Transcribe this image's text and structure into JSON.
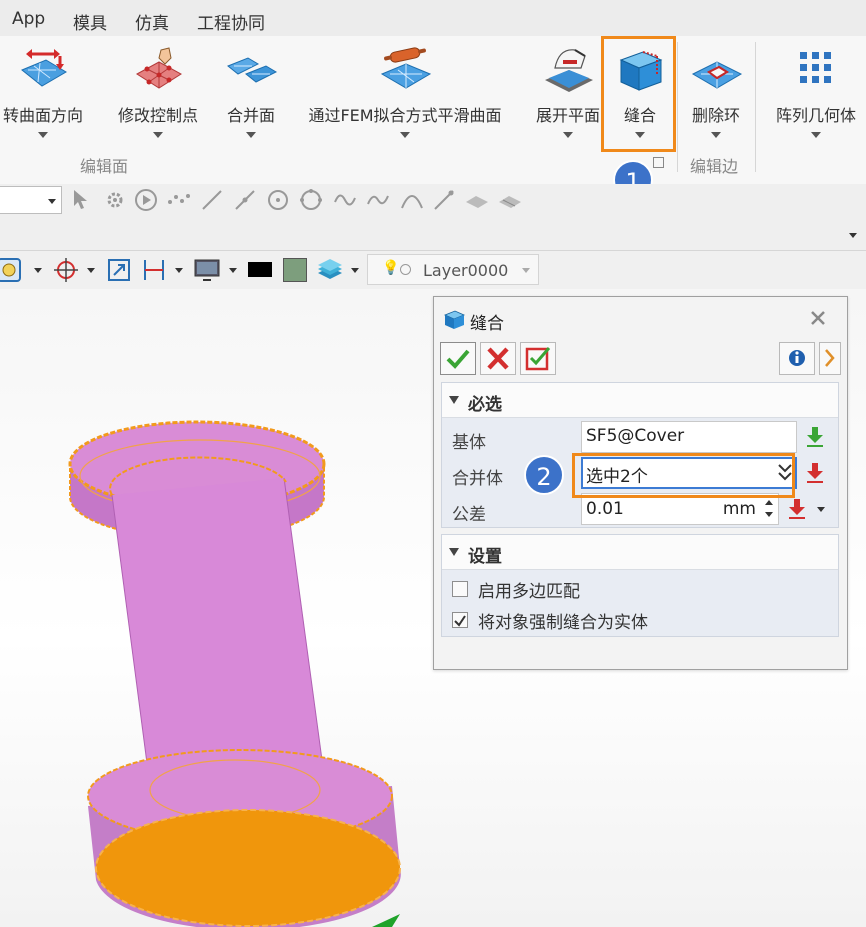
{
  "menu": {
    "items": [
      "App",
      "模具",
      "仿真",
      "工程协同"
    ]
  },
  "ribbon": {
    "buttons": {
      "reverse": "转曲面方向",
      "modify": "修改控制点",
      "merge": "合并面",
      "fem": "通过FEM拟合方式平滑曲面",
      "unfold": "展开平面",
      "sew": "缝合",
      "delete_loop": "删除环",
      "array": "阵列几何体"
    },
    "groups": {
      "edit_face": "编辑面",
      "edit_edge": "编辑边"
    },
    "step1": "1"
  },
  "toolbar": {
    "layer": "Layer0000"
  },
  "dialog": {
    "title": "缝合",
    "required": {
      "heading": "必选",
      "base_label": "基体",
      "base_value": "SF5@Cover",
      "merge_label": "合并体",
      "merge_value": "选中2个",
      "tolerance_label": "公差",
      "tolerance_value": "0.01",
      "tolerance_unit": "mm"
    },
    "settings": {
      "heading": "设置",
      "multi_edge_label": "启用多边匹配",
      "multi_edge_checked": false,
      "force_solid_label": "将对象强制缝合为实体",
      "force_solid_checked": true
    },
    "step2": "2"
  },
  "colors": {
    "accent": "#f0891a",
    "badge": "#3c72c9",
    "model": "#d986d3",
    "edge": "#f29a1c"
  }
}
